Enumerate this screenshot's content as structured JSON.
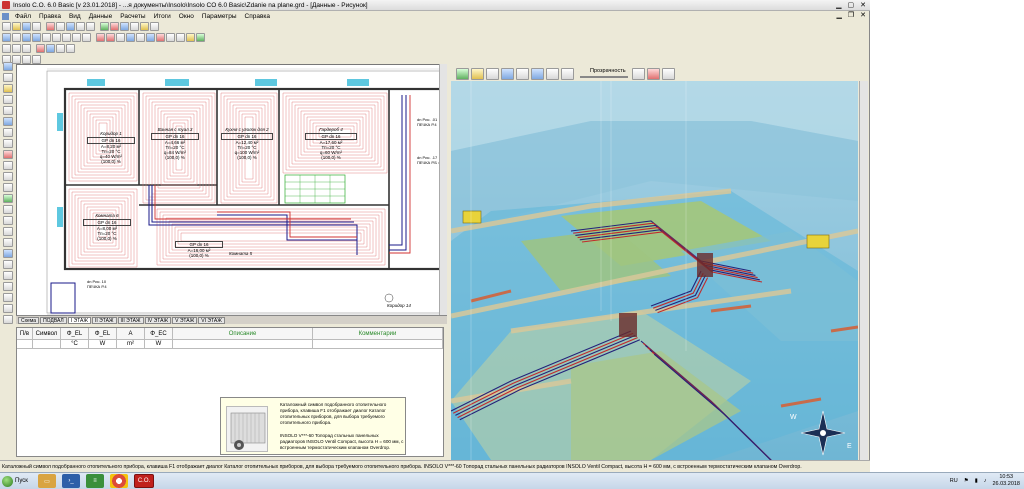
{
  "window": {
    "title": "Insolo C.O. 6.0 Basic [v 23.01.2018] - ...я документы\\Insolo\\Insolo CO 6.0 Basic\\Zdanie na plane.grd - [Данные - Рисунок]"
  },
  "menu": [
    "Файл",
    "Правка",
    "Вид",
    "Данные",
    "Расчеты",
    "Итоги",
    "Окно",
    "Параметры",
    "Справка"
  ],
  "plan": {
    "rooms": [
      {
        "name": "Коридор 1",
        "gp": "GP dn 16",
        "lines": [
          "A=8,20 м²",
          "Tп=20 °C",
          "q=40 W/m²"
        ],
        "pct": "(100,0) %"
      },
      {
        "name": "Ванная с туал.3",
        "gp": "GP dn 16",
        "lines": [
          "A=4,66 м²",
          "Tп=20 °C",
          "q=84 W/m²"
        ],
        "pct": "(100,0) %"
      },
      {
        "name": "Кухня с уголок для 2",
        "gp": "GP dn 16",
        "lines": [
          "A=12,40 м²",
          "Tп=20 °C",
          "q=100 W/m²"
        ],
        "pct": "(100,0) %"
      },
      {
        "name": "Гардероб 4",
        "gp": "GP dn 16",
        "lines": [
          "A=17,60 м²",
          "Tп=20 °C",
          "q=60 W/m²"
        ],
        "pct": "(100,0) %"
      },
      {
        "name": "Комната 6",
        "gp": "GP dn 16",
        "lines": [
          "A=8,00 м²",
          "Tп=20 °C"
        ],
        "pct": "(100,0) %"
      },
      {
        "name": "Комната 5",
        "gp": "GP dn 16",
        "lines": [
          "A=16,00 м²"
        ],
        "pct": "(100,0) %"
      },
      {
        "name": "Коридор 14",
        "gp": "",
        "lines": [],
        "pct": ""
      }
    ],
    "riser_labels": [
      "dn Рис. .01",
      "dn Рис. .17",
      "dn Рис. 10",
      "dn Рис. 14",
      "ПЕЧКА Р.4",
      "ПЕЧКА Р.Б 4"
    ],
    "sheet_tabs": [
      "Схема",
      "ПОДВАЛ",
      "I ЭТАЖ",
      "II ЭТАЖ",
      "III ЭТАЖ",
      "IV ЭТАЖ",
      "V ЭТАЖ",
      "VI ЭТАЖ"
    ]
  },
  "grid": {
    "columns": [
      "П/в",
      "Символ",
      "Φ_EL",
      "Φ_EL",
      "A",
      "Φ_EC",
      "Описание",
      "Комментарии"
    ],
    "units": [
      "",
      "",
      "°C",
      "W",
      "m²",
      "W",
      "",
      ""
    ]
  },
  "tooltip": {
    "text1": "Каталожный символ подобранного отопительного прибора, клавиша F1 отображает диалог Каталог отопительных приборов, для выбора требуемого отопительного прибора.",
    "text2": "INSOLO V***-60 Топорад стальных панельных радиаторов INSOLO Ventil Compact, высота H = 600 мм, с встроенным термостатическим клапаном Overdrop."
  },
  "view3d": {
    "toolbar_label": "Прозрачность",
    "compass": [
      "W",
      "E"
    ]
  },
  "status": {
    "text": "Каталожный символ подобранного отопительного прибора, клавиша F1 отображает диалог Каталог отопительных приборов, для выбора требуемого отопительного прибора.   INSOLO V***-60 Топорад стальных панельных радиаторов INSOLO Ventil Compact, высота H = 600 мм, с встроенным термостатическим клапаном Overdrop."
  },
  "taskbar": {
    "start": "Пуск",
    "apps": [
      "explorer",
      "powershell",
      "notepad",
      "chrome",
      "insolo"
    ],
    "app_labels": {
      "insolo": "C.O."
    },
    "lang": "RU",
    "time": "10:53",
    "date": "26.03.2018"
  }
}
